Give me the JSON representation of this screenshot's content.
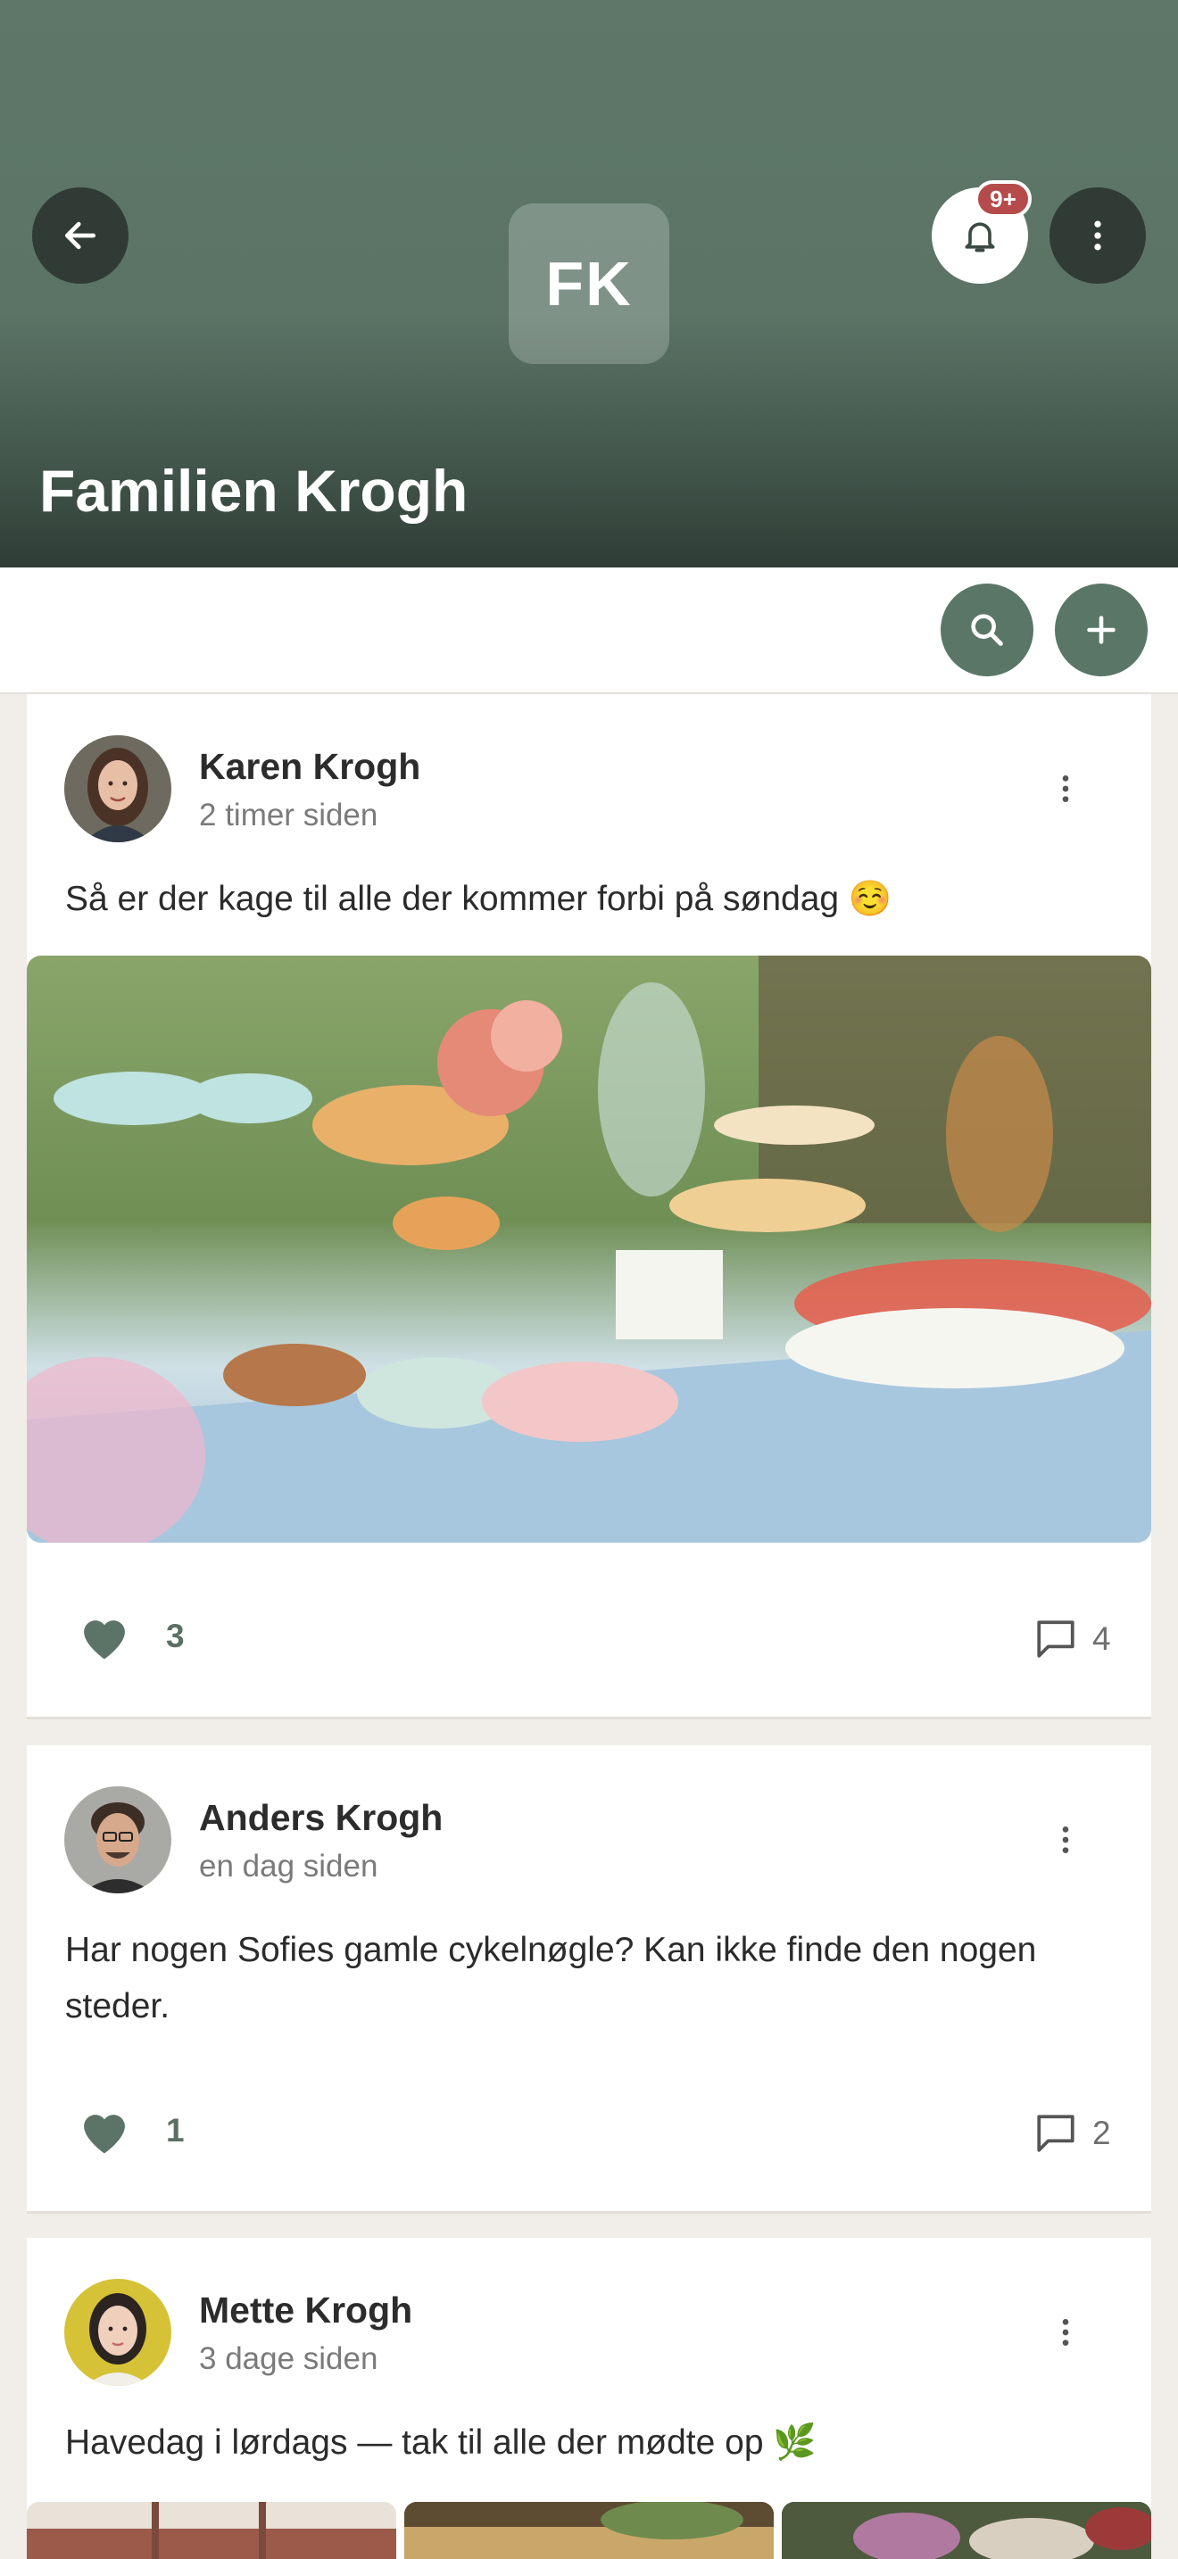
{
  "header": {
    "group_initials": "FK",
    "group_name": "Familien Krogh",
    "notification_badge": "9+",
    "accent_color": "#5a7667"
  },
  "posts": [
    {
      "author": "Karen Krogh",
      "time": "2 timer siden",
      "text": "Så er der kage til alle der kommer forbi på søndag ☺️",
      "likes": "3",
      "comments": "4",
      "image": "party-table-with-cakes"
    },
    {
      "author": "Anders Krogh",
      "time": "en dag siden",
      "text": "Har nogen Sofies gamle cykelnøgle? Kan ikke finde den nogen steder.",
      "likes": "1",
      "comments": "2"
    },
    {
      "author": "Mette Krogh",
      "time": "3 dage siden",
      "text": "Havedag i lørdags — tak til alle der mødte op 🌿"
    }
  ],
  "icons": {
    "back": "arrow-left-icon",
    "bell": "bell-icon",
    "more": "more-vertical-icon",
    "search": "search-icon",
    "add": "plus-icon",
    "like": "heart-icon",
    "comment": "comment-icon"
  }
}
